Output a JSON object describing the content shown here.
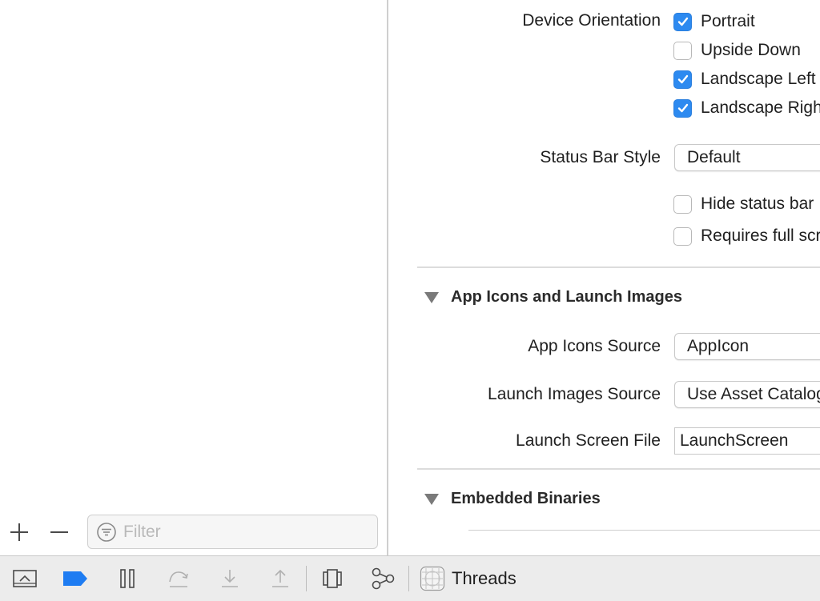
{
  "navigator": {
    "add_label": "+",
    "filter": {
      "placeholder": "Filter",
      "value": ""
    }
  },
  "deployment_info": {
    "device_orientation": {
      "label": "Device Orientation",
      "options": [
        {
          "label": "Portrait",
          "checked": true
        },
        {
          "label": "Upside Down",
          "checked": false
        },
        {
          "label": "Landscape Left",
          "checked": true
        },
        {
          "label": "Landscape Right",
          "checked": true
        }
      ]
    },
    "status_bar_style": {
      "label": "Status Bar Style",
      "value": "Default"
    },
    "status_options": [
      {
        "label": "Hide status bar",
        "checked": false
      },
      {
        "label": "Requires full screen",
        "checked": false
      }
    ]
  },
  "app_icons_section": {
    "title": "App Icons and Launch Images",
    "app_icons_source": {
      "label": "App Icons Source",
      "value": "AppIcon"
    },
    "launch_images_source": {
      "label": "Launch Images Source",
      "value": "Use Asset Catalog"
    },
    "launch_screen_file": {
      "label": "Launch Screen File",
      "value": "LaunchScreen"
    }
  },
  "embedded_binaries_section": {
    "title": "Embedded Binaries"
  },
  "debug_bar": {
    "thread_selector_label": "Threads"
  },
  "colors": {
    "accent": "#2d8af0",
    "debug_bar_bg": "#ececec",
    "breakpoint_active": "#1e7cf2"
  }
}
